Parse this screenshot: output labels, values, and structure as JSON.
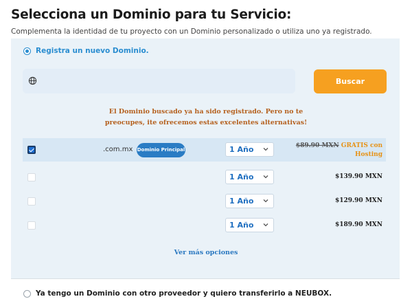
{
  "header": {
    "title": "Selecciona un Dominio para tu Servicio:",
    "subtitle": "Complementa la identidad de tu proyecto con un Dominio personalizado o utiliza uno ya registrado."
  },
  "option_new": {
    "label": "Registra un nuevo Dominio.",
    "selected": true
  },
  "search": {
    "value": "",
    "placeholder": "",
    "button_label": "Buscar"
  },
  "notice": {
    "line1": "El Dominio buscado ya ha sido registrado. Pero no te",
    "line2": "preocupes, ite ofrecemos estas excelentes alternativas!"
  },
  "results": [
    {
      "checked": true,
      "extension": ".com.mx",
      "badge": "Dominio Principal",
      "period": "1 Año",
      "old_price": "$89.90 MXN",
      "price_line1": "GRATIS con",
      "price_line2": "Hosting"
    },
    {
      "checked": false,
      "extension": "",
      "period": "1 Año",
      "price": "$139.90 MXN"
    },
    {
      "checked": false,
      "extension": "",
      "period": "1 Año",
      "price": "$129.90 MXN"
    },
    {
      "checked": false,
      "extension": "",
      "period": "1 Año",
      "price": "$189.90 MXN"
    }
  ],
  "more_options": "Ver más opciones",
  "option_transfer": {
    "label": "Ya tengo un Dominio con otro proveedor y quiero transferirlo a NEUBOX.",
    "selected": false
  },
  "colors": {
    "accent_blue": "#2a8dd0",
    "button_orange": "#f6a020",
    "notice_text": "#b5611f",
    "gratis_text": "#e79216",
    "panel_bg": "#eaf2f8"
  },
  "icons": {
    "search_field": "globe-icon",
    "select_chevron": "chevron-down-icon"
  }
}
